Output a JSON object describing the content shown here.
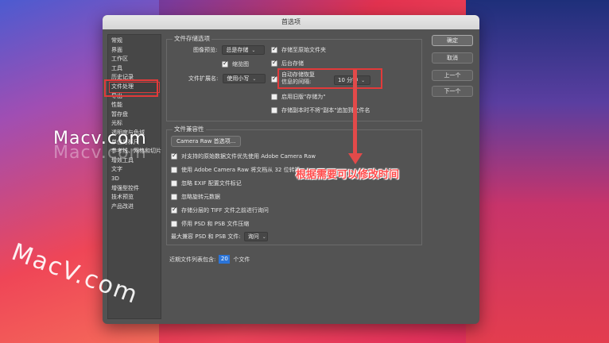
{
  "window": {
    "title": "首选项"
  },
  "sidebar": {
    "items": [
      {
        "label": "常规"
      },
      {
        "label": "界面"
      },
      {
        "label": "工作区"
      },
      {
        "label": "工具"
      },
      {
        "label": "历史记录"
      },
      {
        "label": "文件处理"
      },
      {
        "label": "导出"
      },
      {
        "label": "性能"
      },
      {
        "label": "暂存盘"
      },
      {
        "label": "光标"
      },
      {
        "label": "透明度与色域"
      },
      {
        "label": "单位与标尺"
      },
      {
        "label": "参考线、网格和切片"
      },
      {
        "label": "增效工具"
      },
      {
        "label": "文字"
      },
      {
        "label": "3D"
      },
      {
        "label": "增强型控件"
      },
      {
        "label": "技术预览"
      },
      {
        "label": "产品改进"
      }
    ]
  },
  "file_save": {
    "section_label": "文件存储选项",
    "image_preview_label": "图像预览:",
    "image_preview_value": "总是存储",
    "thumbnail_label": "缩览图",
    "file_ext_label": "文件扩展名:",
    "file_ext_value": "使用小写",
    "save_original_folder": "存储至原始文件夹",
    "background_save": "后台存储",
    "autosave_label_line1": "自动存储恢复",
    "autosave_label_line2": "信息的间隔:",
    "autosave_value": "10 分钟",
    "legacy_save_as": "启用旧版\"存储为\"",
    "save_copy_no_suffix": "存储副本时不将\"副本\"追加到文件名"
  },
  "file_compat": {
    "section_label": "文件兼容性",
    "camera_raw_button": "Camera Raw 首选项...",
    "prefer_acr": "对支持的原始数据文件优先使用 Adobe Camera Raw",
    "acr_convert": "使用 Adobe Camera Raw 将文档从 32 位转换",
    "ignore_exif": "忽略 EXIF 配置文件标记",
    "ignore_rotation": "忽略旋转元数据",
    "ask_tiff": "存储分层的 TIFF 文件之前进行询问",
    "disable_psb": "停用 PSD 和 PSB 文件压缩",
    "max_compat_label": "最大兼容 PSD 和 PSB 文件:",
    "max_compat_value": "询问"
  },
  "recent_files": {
    "label": "近期文件列表包含:",
    "value": "20",
    "suffix": "个文件"
  },
  "buttons": {
    "ok": "确定",
    "cancel": "取消",
    "prev": "上一个",
    "next": "下一个"
  },
  "annotation": {
    "text": "根据需要可以修改时间"
  },
  "watermarks": {
    "top": "Macv.com",
    "bottom": "MacV.com"
  },
  "colors": {
    "highlight_red": "#e23a3a",
    "dialog_bg": "#535353",
    "accent_blue": "#2b74d8"
  }
}
